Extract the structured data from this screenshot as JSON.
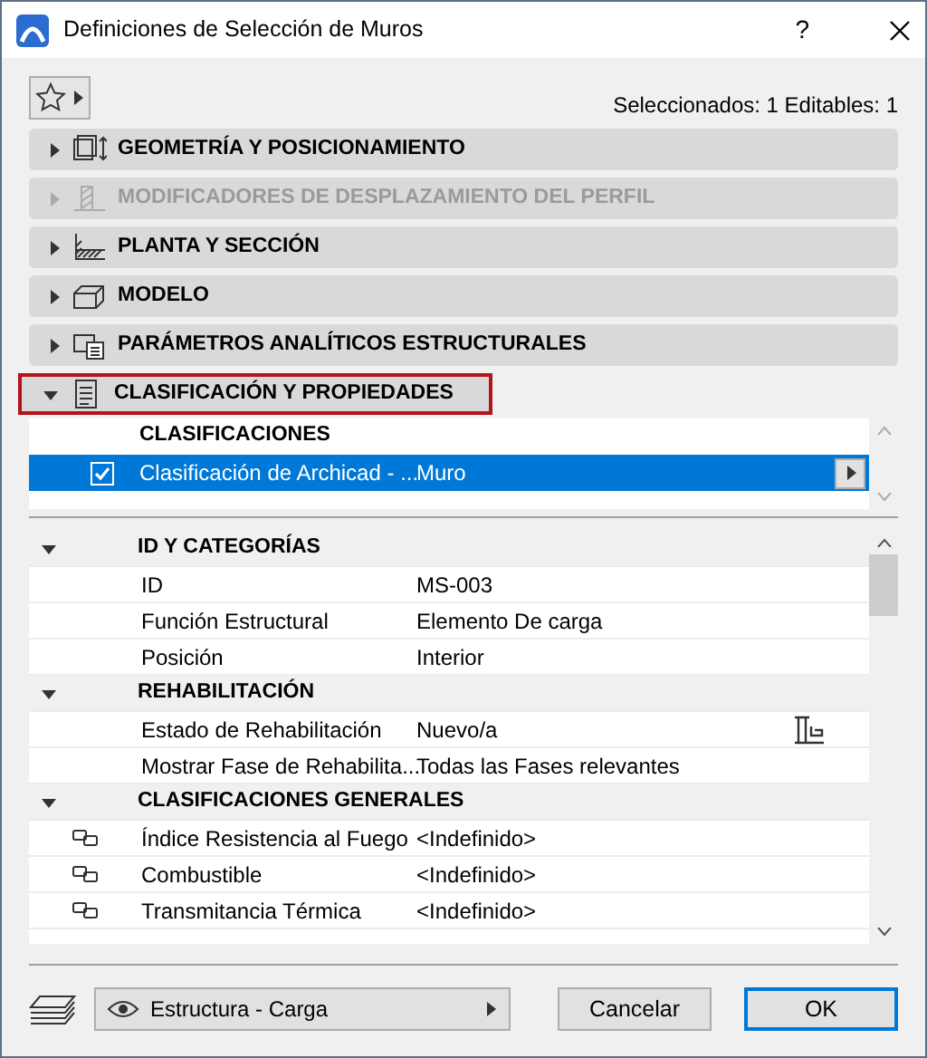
{
  "window": {
    "title": "Definiciones de Selección de Muros",
    "help": "?"
  },
  "toolbar": {
    "selection_info": "Seleccionados: 1 Editables: 1"
  },
  "panels": [
    {
      "label": "GEOMETRÍA Y POSICIONAMIENTO",
      "expanded": false,
      "disabled": false,
      "highlighted": false
    },
    {
      "label": "MODIFICADORES DE DESPLAZAMIENTO DEL PERFIL",
      "expanded": false,
      "disabled": true,
      "highlighted": false
    },
    {
      "label": "PLANTA Y SECCIÓN",
      "expanded": false,
      "disabled": false,
      "highlighted": false
    },
    {
      "label": "MODELO",
      "expanded": false,
      "disabled": false,
      "highlighted": false
    },
    {
      "label": "PARÁMETROS ANALÍTICOS ESTRUCTURALES",
      "expanded": false,
      "disabled": false,
      "highlighted": false
    },
    {
      "label": "CLASIFICACIÓN Y PROPIEDADES",
      "expanded": true,
      "disabled": false,
      "highlighted": true
    }
  ],
  "classifications": {
    "heading": "CLASIFICACIONES",
    "rows": [
      {
        "name": "Clasificación de Archicad - ...",
        "value": "Muro",
        "checked": true,
        "selected": true
      }
    ]
  },
  "properties": [
    {
      "title": "ID Y CATEGORÍAS",
      "expanded": true,
      "rows": [
        {
          "kind": "plain",
          "label": "ID",
          "value": "MS-003"
        },
        {
          "kind": "plain",
          "label": "Función Estructural",
          "value": "Elemento De carga"
        },
        {
          "kind": "plain",
          "label": "Posición",
          "value": "Interior"
        }
      ]
    },
    {
      "title": "REHABILITACIÓN",
      "expanded": true,
      "rows": [
        {
          "kind": "phase",
          "label": "Estado de Rehabilitación",
          "value": "Nuevo/a"
        },
        {
          "kind": "plain",
          "label": "Mostrar Fase de Rehabilita...",
          "value": "Todas las Fases relevantes"
        }
      ]
    },
    {
      "title": "CLASIFICACIONES GENERALES",
      "expanded": true,
      "rows": [
        {
          "kind": "linked",
          "label": "Índice Resistencia al Fuego",
          "value": "<Indefinido>"
        },
        {
          "kind": "linked",
          "label": "Combustible",
          "value": "<Indefinido>"
        },
        {
          "kind": "linked",
          "label": "Transmitancia Térmica",
          "value": "<Indefinido>"
        }
      ]
    }
  ],
  "footer": {
    "view": "Estructura - Carga",
    "buttons": [
      {
        "label": "Cancelar",
        "default": false
      },
      {
        "label": "OK",
        "default": true
      }
    ]
  }
}
